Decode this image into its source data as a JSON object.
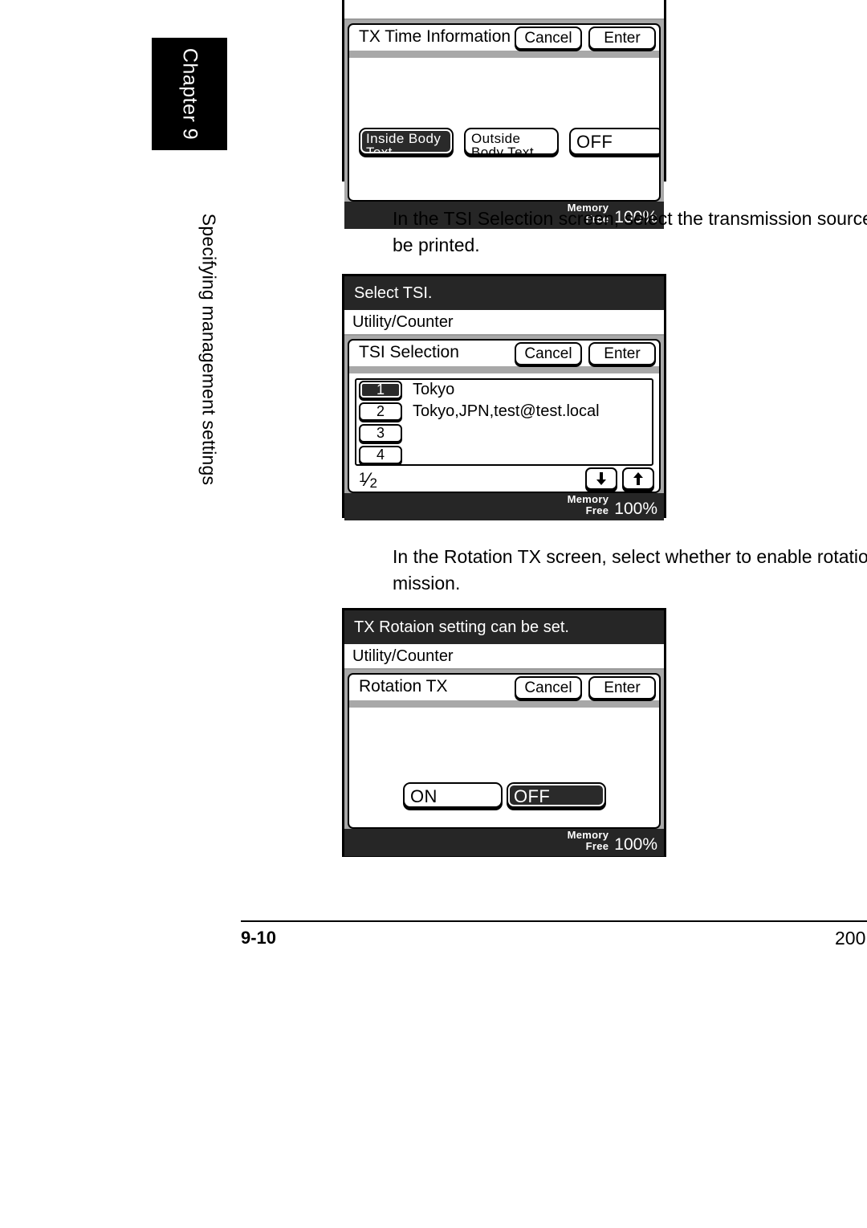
{
  "document": {
    "chapter_tab": "Chapter 9",
    "running_head": "Specifying management settings",
    "folio": "9-10",
    "footer_right": "200"
  },
  "paragraphs": {
    "p1": "In the TSI Selection screen, select the transmission source\nbe printed.",
    "p2": "In the Rotation TX screen, select whether to enable rotatio\nmission."
  },
  "panels": {
    "tx_time_information": {
      "dialog_title": "TX Time Information",
      "cancel_label": "Cancel",
      "enter_label": "Enter",
      "keys": [
        {
          "label": "Inside Body\nText",
          "selected": true
        },
        {
          "label": "Outside\nBody Text",
          "selected": false
        },
        {
          "label": "OFF",
          "selected": false
        }
      ],
      "status": {
        "memory_line1": "Memory",
        "memory_line2": "Free",
        "percent": "100%"
      }
    },
    "tsi_selection": {
      "prompt": "Select TSI.",
      "menu": "Utility/Counter",
      "dialog_title": "TSI Selection",
      "cancel_label": "Cancel",
      "enter_label": "Enter",
      "rows": [
        {
          "number": "1",
          "text": "Tokyo",
          "selected": true
        },
        {
          "number": "2",
          "text": "Tokyo,JPN,test@test.local",
          "selected": false
        },
        {
          "number": "3",
          "text": "",
          "selected": false
        },
        {
          "number": "4",
          "text": "",
          "selected": false
        }
      ],
      "page_numerator": "1",
      "page_denominator": "2",
      "scroll_down_icon": "arrow-down-icon",
      "scroll_up_icon": "arrow-up-icon",
      "status": {
        "memory_line1": "Memory",
        "memory_line2": "Free",
        "percent": "100%"
      }
    },
    "rotation_tx": {
      "prompt": "TX Rotaion setting can be set.",
      "menu": "Utility/Counter",
      "dialog_title": "Rotation TX",
      "cancel_label": "Cancel",
      "enter_label": "Enter",
      "keys": [
        {
          "label": "ON",
          "selected": false
        },
        {
          "label": "OFF",
          "selected": true
        }
      ],
      "status": {
        "memory_line1": "Memory",
        "memory_line2": "Free",
        "percent": "100%"
      }
    }
  },
  "colors": {
    "lcd_prompt_bg": "#262626",
    "lcd_body_bg": "#a8a8a8",
    "selected_key_bg": "#2a2a2a",
    "rule": "#9a9a9a"
  }
}
